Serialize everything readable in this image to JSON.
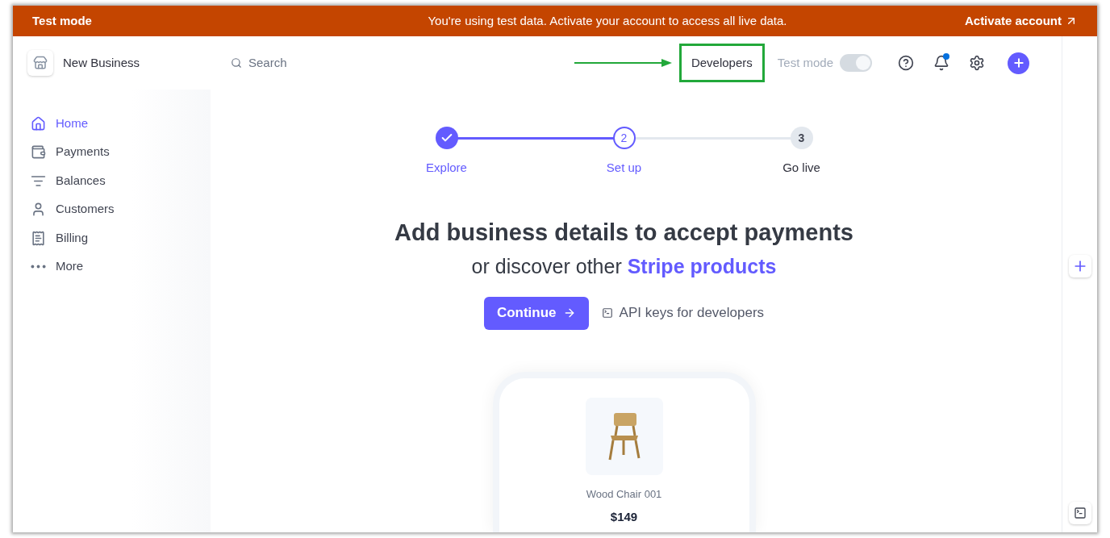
{
  "banner": {
    "label": "Test mode",
    "message": "You're using test data. Activate your account to access all live data.",
    "action": "Activate account"
  },
  "account": {
    "name": "New Business"
  },
  "search": {
    "placeholder": "Search"
  },
  "header": {
    "developers": {
      "label": "Developers",
      "highlighted": true
    },
    "test_mode": {
      "label": "Test mode",
      "on": true,
      "disabled": true
    },
    "notifications_unread": true
  },
  "sidebar": {
    "items": [
      {
        "label": "Home",
        "selected": true
      },
      {
        "label": "Payments",
        "selected": false
      },
      {
        "label": "Balances",
        "selected": false
      },
      {
        "label": "Customers",
        "selected": false
      },
      {
        "label": "Billing",
        "selected": false
      },
      {
        "label": "More",
        "selected": false
      }
    ]
  },
  "steps": [
    {
      "label": "Explore",
      "kind": "done"
    },
    {
      "marker": "2",
      "label": "Set up",
      "kind": "current"
    },
    {
      "marker": "3",
      "label": "Go live",
      "kind": "upcoming"
    }
  ],
  "hero": {
    "title": "Add business details to accept payments",
    "subtitle": "or discover other **Stripe products**",
    "primary": "Continue",
    "secondary": "API keys for developers"
  },
  "product": {
    "name": "Wood Chair 001",
    "price": "$149"
  }
}
